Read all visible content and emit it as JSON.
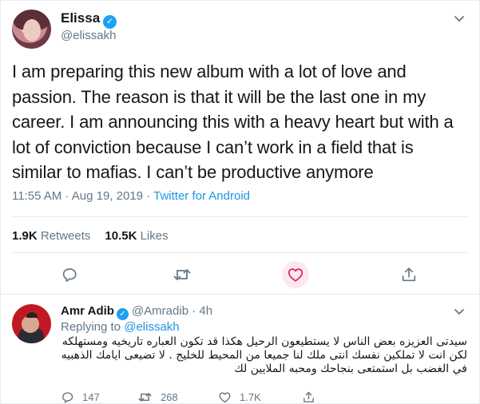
{
  "main_tweet": {
    "name": "Elissa",
    "handle": "@elissakh",
    "text": "I am preparing this new album with a lot of love and passion. The reason is that it will be the last one in my career. I am announcing this with a heavy heart but with a lot of conviction because I can’t work in a field that is similar to mafias. I can’t be productive anymore",
    "time": "11:55 AM",
    "separator": "·",
    "date": "Aug 19, 2019",
    "source": "Twitter for Android",
    "retweets_count": "1.9K",
    "retweets_label": "Retweets",
    "likes_count": "10.5K",
    "likes_label": "Likes",
    "liked_color": "#e0245e"
  },
  "reply_tweet": {
    "name": "Amr Adib",
    "handle": "@Amradib",
    "separator": "·",
    "age": "4h",
    "replying_label": "Replying to",
    "replying_to": "@elissakh",
    "text": "سيدتى العزيزه بعض الناس لا يستطيعون الرحيل هكذا قد تكون العباره تاريخيه ومستهلكه لكن انت لا تملكين نفسك انتى ملك لنا جميعا من المحيط للخليج . لا تضيعى ايامك الذهبيه في الغضب بل استمتعى بنجاحك ومحبه الملايين لك",
    "replies": "147",
    "retweets": "268",
    "likes": "1.7K"
  },
  "icons": {
    "verified": "verified-check-icon",
    "caret": "chevron-down-icon",
    "reply": "reply-bubble-icon",
    "retweet": "retweet-arrows-icon",
    "like": "heart-icon",
    "share": "share-upload-icon"
  },
  "colors": {
    "accent": "#1da1f2",
    "link": "#1b95e0",
    "muted": "#657786",
    "text": "#14171a"
  }
}
